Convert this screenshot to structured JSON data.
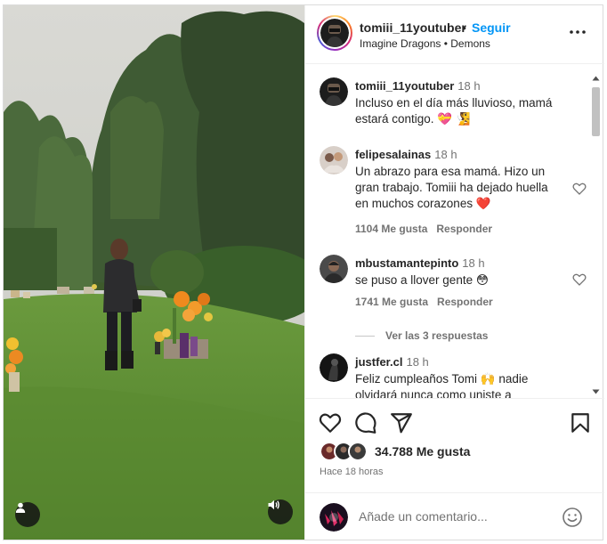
{
  "post": {
    "author": "tomiii_11youtuber",
    "separator": "•",
    "follow_label": "Seguir",
    "audio": "Imagine Dragons • Demons",
    "more_icon": "more-horizontal-icon"
  },
  "comments": [
    {
      "user": "tomiii_11youtuber",
      "time": "18 h",
      "text": "Incluso en el día más lluvioso, mamá estará contigo. 💝 🧏",
      "is_caption": true
    },
    {
      "user": "felipesalainas",
      "time": "18 h",
      "text": "Un abrazo para esa mamá. Hizo un gran trabajo. Tomiii ha dejado huella en muchos corazones ❤️",
      "likes": "1104 Me gusta",
      "reply": "Responder"
    },
    {
      "user": "mbustamantepinto",
      "time": "18 h",
      "text": "se puso a llover gente 😳",
      "likes": "1741 Me gusta",
      "reply": "Responder",
      "view_replies": "Ver las 3 respuestas"
    },
    {
      "user": "justfer.cl",
      "time": "18 h",
      "text": "Feliz cumpleaños Tomi 🙌 nadie olvidará nunca como uniste a"
    }
  ],
  "actions": {
    "like_icon": "heart-icon",
    "comment_icon": "comment-icon",
    "share_icon": "share-icon",
    "save_icon": "bookmark-icon"
  },
  "likes_text": "34.788 Me gusta",
  "posted": "Hace 18 horas",
  "add_comment": {
    "placeholder": "Añade un comentario...",
    "emoji_icon": "emoji-icon"
  },
  "colors": {
    "follow": "#0095f6",
    "like_heart": "#ed4956",
    "muted": "#737373"
  }
}
